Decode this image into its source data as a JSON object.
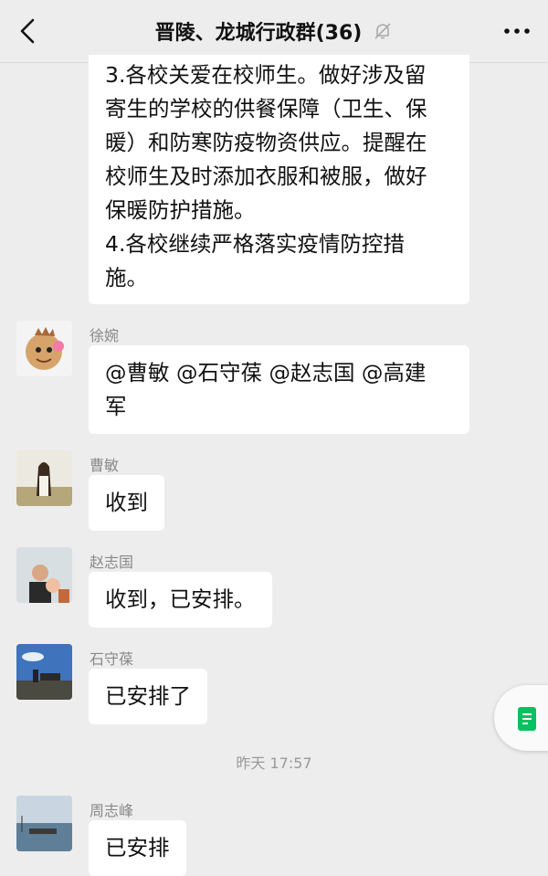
{
  "header": {
    "title": "晋陵、龙城行政群(36)",
    "back_icon": "chevron-left-icon",
    "mute_icon": "bell-off-icon",
    "more_icon": "more-dots-icon"
  },
  "messages": [
    {
      "sender": "",
      "text": "3.各校关爱在校师生。做好涉及留\n寄生的学校的供餐保障（卫生、保\n暖）和防寒防疫物资供应。提醒在\n校师生及时添加衣服和被服，做好\n保暖防护措施。\n4.各校继续严格落实疫情防控措\n施。"
    },
    {
      "sender": "徐婉",
      "text": "@曹敏 @石守葆 @赵志国 @高建\n军"
    },
    {
      "sender": "曹敏",
      "text": "收到"
    },
    {
      "sender": "赵志国",
      "text": "收到，已安排。"
    },
    {
      "sender": "石守葆",
      "text": "已安排了"
    },
    {
      "sender": "周志峰",
      "text": "已安排"
    }
  ],
  "timestamp": "昨天 17:57",
  "floating_button_icon": "document-icon",
  "colors": {
    "background": "#ededed",
    "bubble": "#ffffff",
    "accent_green": "#07c160"
  }
}
